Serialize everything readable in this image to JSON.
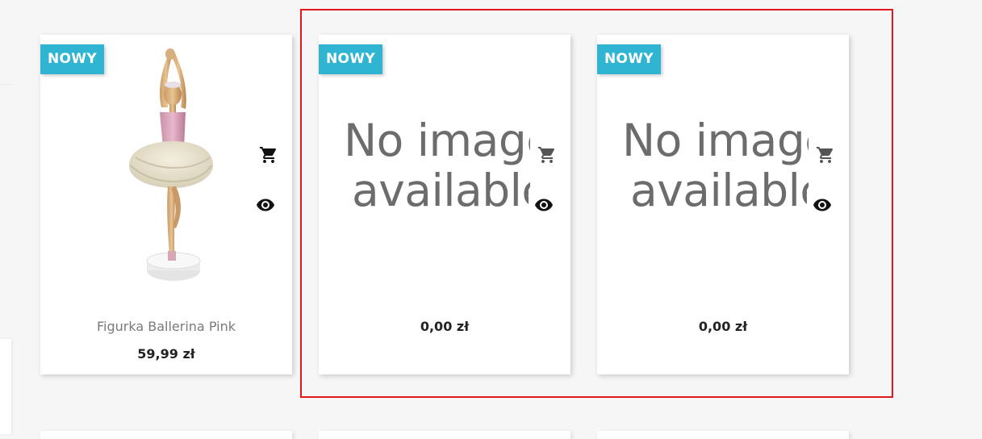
{
  "products": [
    {
      "badge": "NOWY",
      "title": "Figurka Ballerina Pink",
      "price": "59,99 zł",
      "has_image": true,
      "image": "ballerina-figurine",
      "icons": [
        "cart-icon",
        "eye-icon"
      ]
    },
    {
      "badge": "NOWY",
      "title": "",
      "price": "0,00 zł",
      "has_image": false,
      "placeholder_line1": "No image",
      "placeholder_line2": "available",
      "icons": [
        "cart-icon",
        "eye-icon"
      ]
    },
    {
      "badge": "NOWY",
      "title": "",
      "price": "0,00 zł",
      "has_image": false,
      "placeholder_line1": "No image",
      "placeholder_line2": "available",
      "icons": [
        "cart-icon",
        "eye-icon"
      ]
    }
  ],
  "colors": {
    "badge_bg": "#2fb5d2",
    "highlight_border": "#e0191b",
    "page_bg": "#f6f6f6"
  }
}
